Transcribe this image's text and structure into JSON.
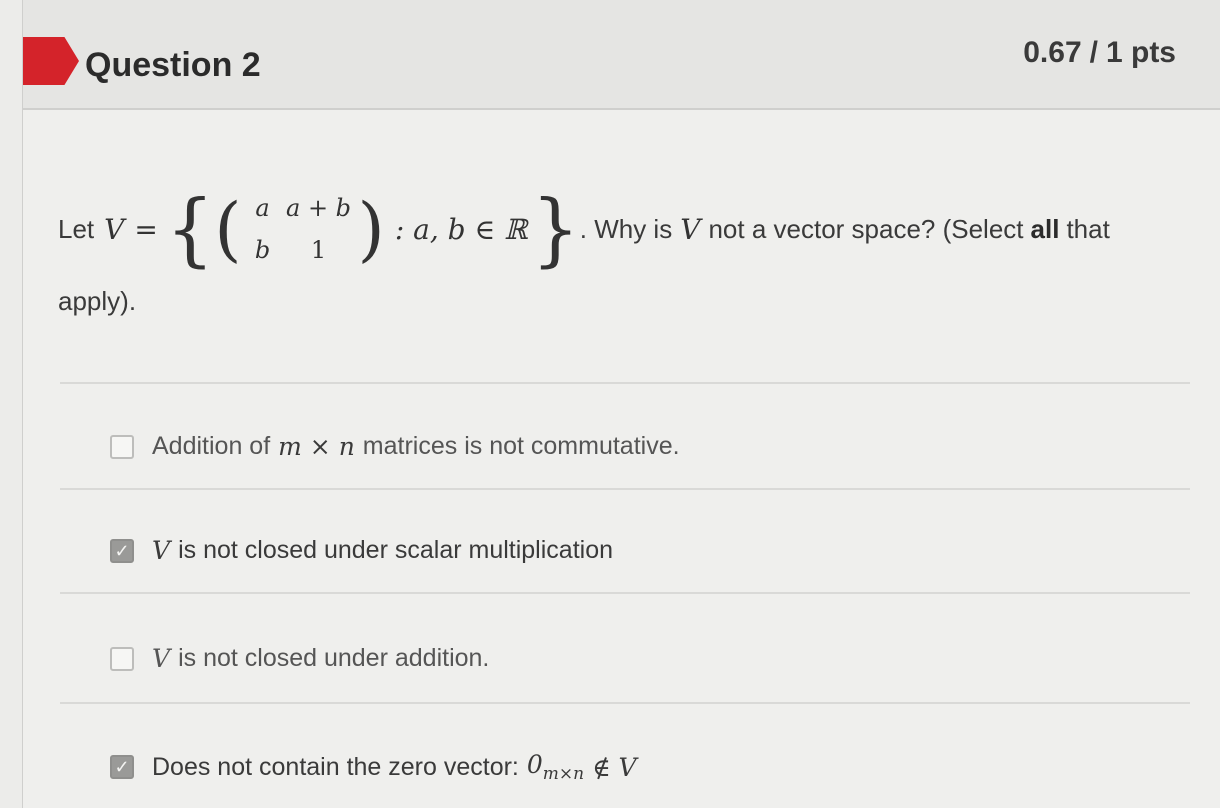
{
  "header": {
    "question_label": "Question 2",
    "points_score": "0.67",
    "points_sep": "/",
    "points_total": "1 pts"
  },
  "prompt": {
    "let": "Let",
    "var_v": "V",
    "equals": "=",
    "brace_open": "{",
    "paren_open": "(",
    "matrix": {
      "r1c1": "a",
      "r1c2": "a + b",
      "r2c1": "b",
      "r2c2": "1"
    },
    "paren_close": ")",
    "condition": ": a, b ∈ ℝ",
    "brace_close": "}",
    "question_pre": ". Why is",
    "question_var": "V",
    "question_mid": "not a vector space? (Select",
    "question_bold": "all",
    "question_post": "that",
    "question_line2": "apply)."
  },
  "options": [
    {
      "checked": false,
      "text_pre": "Addition of",
      "math": "m × n",
      "text_post": "matrices is not commutative."
    },
    {
      "checked": true,
      "math": "V",
      "text_post": "is not closed under scalar multiplication"
    },
    {
      "checked": false,
      "math": "V",
      "text_post": "is not closed under addition."
    },
    {
      "checked": true,
      "text_pre": "Does not contain the zero vector:",
      "math_zero": "0",
      "math_sub": "m×n",
      "math_post": "∉ V"
    }
  ],
  "colors": {
    "accent_flag": "#d4232a",
    "checkbox_checked": "#9a9a98"
  }
}
